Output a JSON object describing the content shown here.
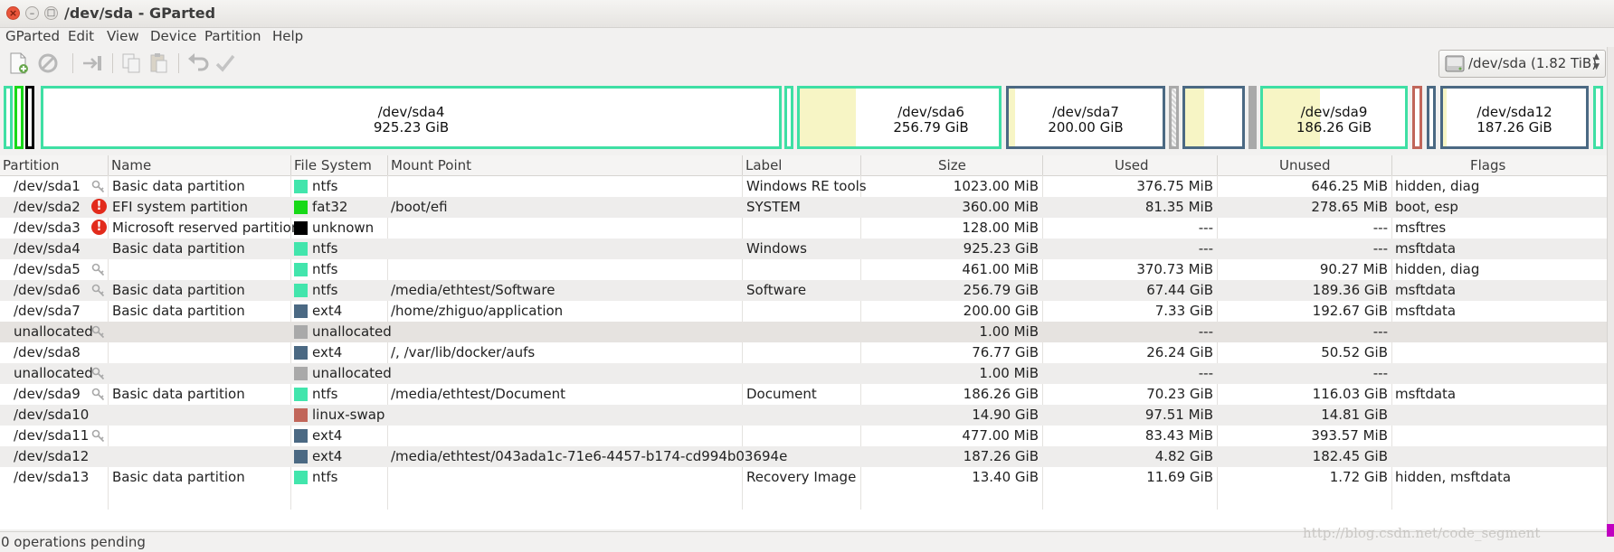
{
  "window": {
    "title": "/dev/sda - GParted"
  },
  "menu": [
    "GParted",
    "Edit",
    "View",
    "Device",
    "Partition",
    "Help"
  ],
  "toolbar": {
    "icons": [
      "new-icon",
      "delete-icon",
      "resize-move-icon",
      "copy-icon",
      "paste-icon",
      "undo-icon",
      "apply-icon"
    ]
  },
  "device_selector": {
    "label": "/dev/sda  (1.82 TiB)"
  },
  "graph": {
    "sda4": {
      "name": "/dev/sda4",
      "size": "925.23 GiB"
    },
    "sda6": {
      "name": "/dev/sda6",
      "size": "256.79 GiB"
    },
    "sda7": {
      "name": "/dev/sda7",
      "size": "200.00 GiB"
    },
    "sda9": {
      "name": "/dev/sda9",
      "size": "186.26 GiB"
    },
    "sda12": {
      "name": "/dev/sda12",
      "size": "187.26 GiB"
    }
  },
  "columns": [
    "Partition",
    "Name",
    "File System",
    "Mount Point",
    "Label",
    "Size",
    "Used",
    "Unused",
    "Flags"
  ],
  "rows": [
    {
      "partition": "/dev/sda1",
      "name": "Basic data partition",
      "fs": "ntfs",
      "mount": "",
      "label": "Windows RE tools",
      "size": "1023.00 MiB",
      "used": "376.75 MiB",
      "unused": "646.25 MiB",
      "flags": "hidden, diag"
    },
    {
      "partition": "/dev/sda2",
      "name": "EFI system partition",
      "fs": "fat32",
      "mount": "/boot/efi",
      "label": "SYSTEM",
      "size": "360.00 MiB",
      "used": "81.35 MiB",
      "unused": "278.65 MiB",
      "flags": "boot, esp"
    },
    {
      "partition": "/dev/sda3",
      "name": "Microsoft reserved partition",
      "fs": "unknown",
      "mount": "",
      "label": "",
      "size": "128.00 MiB",
      "used": "---",
      "unused": "---",
      "flags": "msftres"
    },
    {
      "partition": "/dev/sda4",
      "name": "Basic data partition",
      "fs": "ntfs",
      "mount": "",
      "label": "Windows",
      "size": "925.23 GiB",
      "used": "---",
      "unused": "---",
      "flags": "msftdata"
    },
    {
      "partition": "/dev/sda5",
      "name": "",
      "fs": "ntfs",
      "mount": "",
      "label": "",
      "size": "461.00 MiB",
      "used": "370.73 MiB",
      "unused": "90.27 MiB",
      "flags": "hidden, diag"
    },
    {
      "partition": "/dev/sda6",
      "name": "Basic data partition",
      "fs": "ntfs",
      "mount": "/media/ethtest/Software",
      "label": "Software",
      "size": "256.79 GiB",
      "used": "67.44 GiB",
      "unused": "189.36 GiB",
      "flags": "msftdata"
    },
    {
      "partition": "/dev/sda7",
      "name": "Basic data partition",
      "fs": "ext4",
      "mount": "/home/zhiguo/application",
      "label": "",
      "size": "200.00 GiB",
      "used": "7.33 GiB",
      "unused": "192.67 GiB",
      "flags": "msftdata"
    },
    {
      "partition": "unallocated",
      "name": "",
      "fs": "unallocated",
      "mount": "",
      "label": "",
      "size": "1.00 MiB",
      "used": "---",
      "unused": "---",
      "flags": ""
    },
    {
      "partition": "/dev/sda8",
      "name": "",
      "fs": "ext4",
      "mount": "/, /var/lib/docker/aufs",
      "label": "",
      "size": "76.77 GiB",
      "used": "26.24 GiB",
      "unused": "50.52 GiB",
      "flags": ""
    },
    {
      "partition": "unallocated",
      "name": "",
      "fs": "unallocated",
      "mount": "",
      "label": "",
      "size": "1.00 MiB",
      "used": "---",
      "unused": "---",
      "flags": ""
    },
    {
      "partition": "/dev/sda9",
      "name": "Basic data partition",
      "fs": "ntfs",
      "mount": "/media/ethtest/Document",
      "label": "Document",
      "size": "186.26 GiB",
      "used": "70.23 GiB",
      "unused": "116.03 GiB",
      "flags": "msftdata"
    },
    {
      "partition": "/dev/sda10",
      "name": "",
      "fs": "linux-swap",
      "mount": "",
      "label": "",
      "size": "14.90 GiB",
      "used": "97.51 MiB",
      "unused": "14.81 GiB",
      "flags": ""
    },
    {
      "partition": "/dev/sda11",
      "name": "",
      "fs": "ext4",
      "mount": "",
      "label": "",
      "size": "477.00 MiB",
      "used": "83.43 MiB",
      "unused": "393.57 MiB",
      "flags": ""
    },
    {
      "partition": "/dev/sda12",
      "name": "",
      "fs": "ext4",
      "mount": "/media/ethtest/043ada1c-71e6-4457-b174-cd994b03694e",
      "label": "",
      "size": "187.26 GiB",
      "used": "4.82 GiB",
      "unused": "182.45 GiB",
      "flags": ""
    },
    {
      "partition": "/dev/sda13",
      "name": "Basic data partition",
      "fs": "ntfs",
      "mount": "",
      "label": "Recovery Image",
      "size": "13.40 GiB",
      "used": "11.69 GiB",
      "unused": "1.72 GiB",
      "flags": "hidden, msftdata"
    }
  ],
  "fs_colors": {
    "ntfs": "#42e5ac",
    "fat32": "#18d918",
    "unknown": "#000000",
    "ext4": "#4b6983",
    "unallocated": "#a9a9a9",
    "linux-swap": "#c1665a"
  },
  "status": {
    "text": "0 operations pending"
  },
  "watermark": "http://blog.csdn.net/code_segment"
}
